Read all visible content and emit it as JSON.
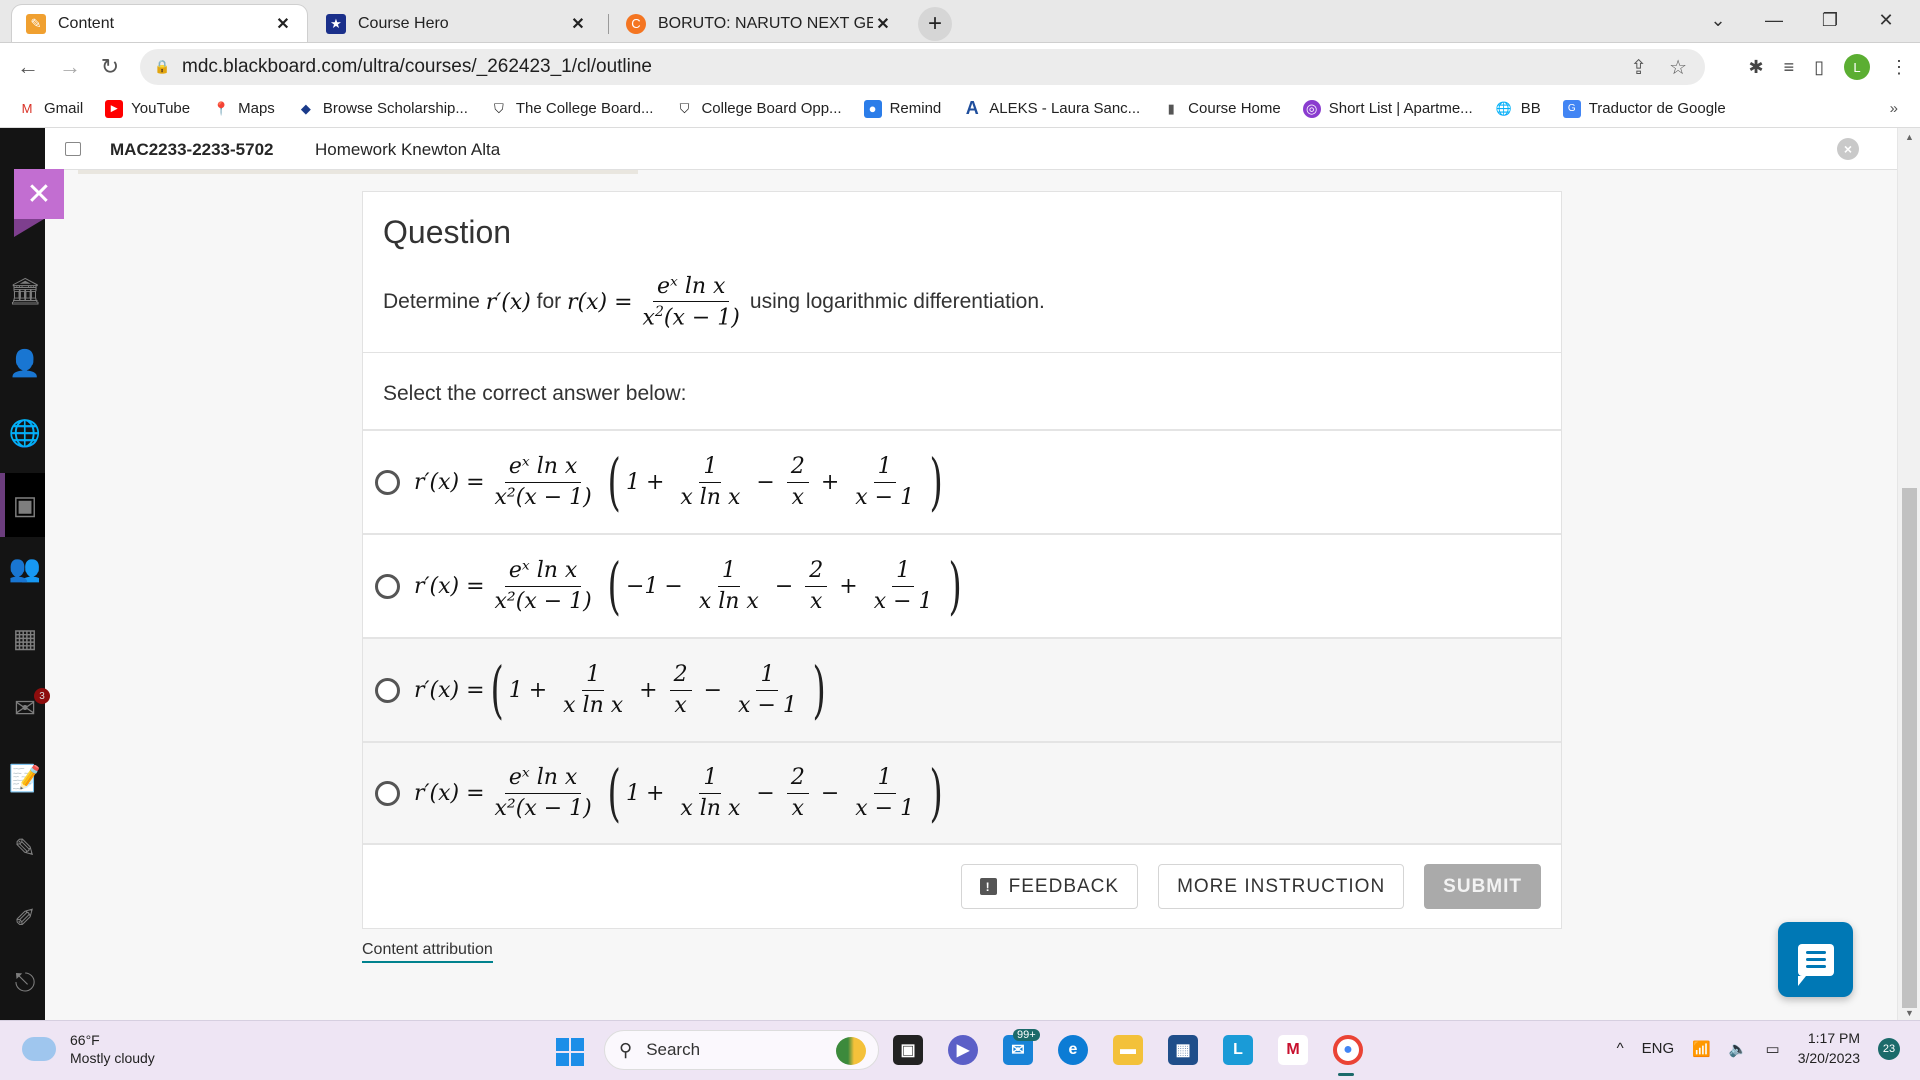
{
  "browser": {
    "tabs": [
      {
        "title": "Content",
        "icon": "pencil-icon",
        "active": true
      },
      {
        "title": "Course Hero",
        "icon": "star-shield-icon",
        "active": false
      },
      {
        "title": "BORUTO: NARUTO NEXT GENERA",
        "icon": "crunchyroll-icon",
        "active": false
      }
    ],
    "new_tab": "+",
    "close_glyph": "✕",
    "window_controls": {
      "dropdown": "⌄",
      "minimize": "—",
      "restore": "❐",
      "close": "✕"
    },
    "url": "mdc.blackboard.com/ultra/courses/_262423_1/cl/outline",
    "profile_initial": "L",
    "bookmarks": [
      {
        "label": "Gmail",
        "icon": "gmail-icon",
        "color": "#d93025"
      },
      {
        "label": "YouTube",
        "icon": "youtube-icon",
        "color": "#ff0000"
      },
      {
        "label": "Maps",
        "icon": "maps-icon",
        "color": "#34a853"
      },
      {
        "label": "Browse Scholarship...",
        "icon": "scholarship-icon",
        "color": "#1a3a8a"
      },
      {
        "label": "The College Board...",
        "icon": "college-board-icon",
        "color": "#222222"
      },
      {
        "label": "College Board Opp...",
        "icon": "college-board-icon",
        "color": "#222222"
      },
      {
        "label": "Remind",
        "icon": "remind-icon",
        "color": "#2b7de9"
      },
      {
        "label": "ALEKS - Laura Sanc...",
        "icon": "aleks-icon",
        "color": "#1f4e9c"
      },
      {
        "label": "Course Home",
        "icon": "tablet-icon",
        "color": "#555555"
      },
      {
        "label": "Short List | Apartme...",
        "icon": "shortlist-icon",
        "color": "#8a3ccf"
      },
      {
        "label": "BB",
        "icon": "globe-icon",
        "color": "#333333"
      },
      {
        "label": "Traductor de Google",
        "icon": "translate-icon",
        "color": "#4285f4"
      }
    ],
    "bookmarks_more": "»"
  },
  "blackboard": {
    "course_code": "MAC2233-2233-5702",
    "breadcrumb": "Homework Knewton Alta",
    "nav_icons": [
      "institution-icon",
      "profile-icon",
      "globe-icon",
      "courses-icon",
      "groups-icon",
      "calendar-icon",
      "messages-icon",
      "grades-icon",
      "tools-icon",
      "edit-icon",
      "signout-icon"
    ],
    "messages_badge": "3",
    "accent": "#c26ed1"
  },
  "question": {
    "heading": "Question",
    "prompt_before": "Determine",
    "prompt_deriv": "r′(x)",
    "prompt_for": "for",
    "prompt_func": "r(x) =",
    "func_num": "eˣ ln x",
    "func_den_base": "x",
    "func_den_exp": "2",
    "func_den_rest": "(x − 1)",
    "prompt_after": "using logarithmic differentiation.",
    "instruction": "Select the correct answer below:",
    "options": [
      {
        "lhs": "r′(x) =",
        "has_prefactor": true,
        "pre_num": "eˣ ln x",
        "pre_den": "x²(x − 1)",
        "t0": "1",
        "op1": "+",
        "f1_num": "1",
        "f1_den": "x ln x",
        "op2": "−",
        "f2_num": "2",
        "f2_den": "x",
        "op3": "+",
        "f3_num": "1",
        "f3_den": "x − 1"
      },
      {
        "lhs": "r′(x) =",
        "has_prefactor": true,
        "pre_num": "eˣ ln x",
        "pre_den": "x²(x − 1)",
        "t0": "−1",
        "op1": "−",
        "f1_num": "1",
        "f1_den": "x ln x",
        "op2": "−",
        "f2_num": "2",
        "f2_den": "x",
        "op3": "+",
        "f3_num": "1",
        "f3_den": "x − 1"
      },
      {
        "lhs": "r′(x) =",
        "has_prefactor": false,
        "pre_num": "",
        "pre_den": "",
        "t0": "1",
        "op1": "+",
        "f1_num": "1",
        "f1_den": "x ln x",
        "op2": "+",
        "f2_num": "2",
        "f2_den": "x",
        "op3": "−",
        "f3_num": "1",
        "f3_den": "x − 1"
      },
      {
        "lhs": "r′(x) =",
        "has_prefactor": true,
        "pre_num": "eˣ ln x",
        "pre_den": "x²(x − 1)",
        "t0": "1",
        "op1": "+",
        "f1_num": "1",
        "f1_den": "x ln x",
        "op2": "−",
        "f2_num": "2",
        "f2_den": "x",
        "op3": "−",
        "f3_num": "1",
        "f3_den": "x − 1"
      }
    ],
    "selected_option": null,
    "buttons": {
      "feedback": "FEEDBACK",
      "more_instruction": "MORE INSTRUCTION",
      "submit": "SUBMIT"
    },
    "content_attribution": "Content attribution"
  },
  "taskbar": {
    "weather_temp": "66°F",
    "weather_desc": "Mostly cloudy",
    "search_label": "Search",
    "mail_badge": "99+",
    "tray_language": "ENG",
    "time": "1:17 PM",
    "date": "3/20/2023",
    "notification_count": "23",
    "tray_chevron": "^"
  }
}
